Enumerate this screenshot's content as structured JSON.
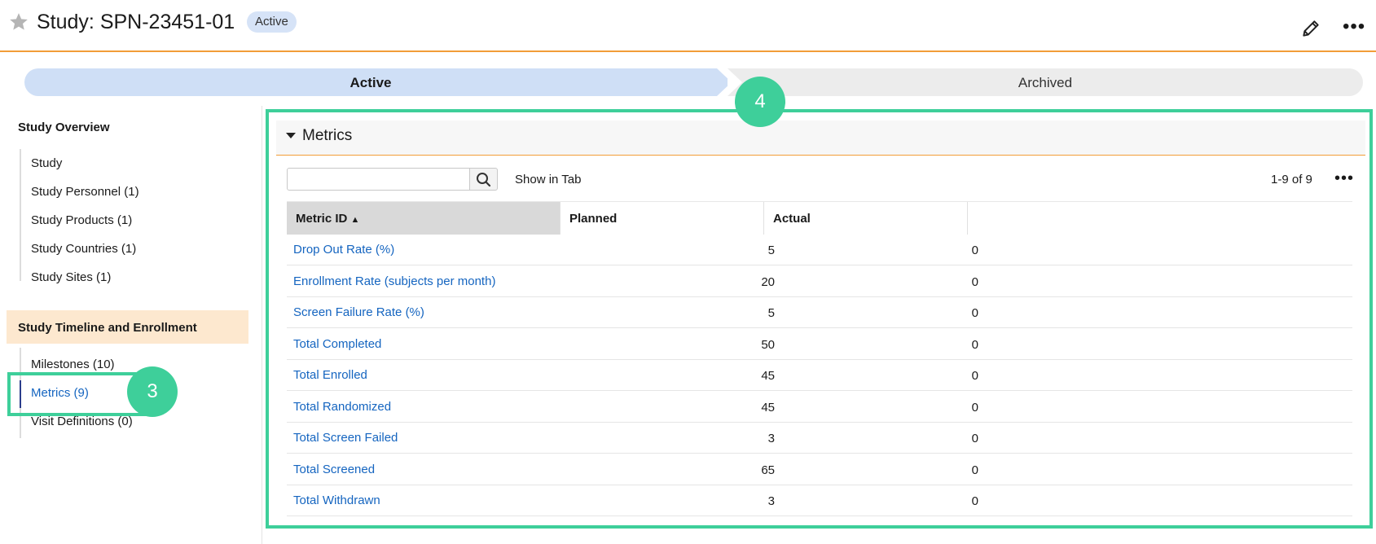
{
  "header": {
    "title": "Study: SPN-23451-01",
    "status_badge": "Active",
    "favorite_icon": "star-icon",
    "edit_icon": "pencil-icon",
    "more_icon": "more-horizontal-icon"
  },
  "lifecycle": {
    "stages": [
      "Active",
      "Archived"
    ],
    "current": "Active"
  },
  "sidebar": {
    "section_overview": "Study Overview",
    "overview_items": [
      "Study",
      "Study Personnel (1)",
      "Study Products (1)",
      "Study Countries (1)",
      "Study Sites (1)"
    ],
    "section_timeline": "Study Timeline and Enrollment",
    "timeline_items": [
      "Milestones (10)",
      "Metrics (9)",
      "Visit Definitions (0)"
    ],
    "active_item": "Metrics (9)"
  },
  "panel": {
    "title": "Metrics",
    "search_placeholder": "",
    "search_icon": "search-icon",
    "show_in_tab": "Show in Tab",
    "count": "1-9 of 9",
    "columns": [
      "Metric ID",
      "Planned",
      "Actual"
    ],
    "sort_column": "Metric ID",
    "rows": [
      {
        "metric": "Drop Out Rate (%)",
        "planned": "5",
        "actual": "0"
      },
      {
        "metric": "Enrollment Rate (subjects per month)",
        "planned": "20",
        "actual": "0"
      },
      {
        "metric": "Screen Failure Rate (%)",
        "planned": "5",
        "actual": "0"
      },
      {
        "metric": "Total Completed",
        "planned": "50",
        "actual": "0"
      },
      {
        "metric": "Total Enrolled",
        "planned": "45",
        "actual": "0"
      },
      {
        "metric": "Total Randomized",
        "planned": "45",
        "actual": "0"
      },
      {
        "metric": "Total Screen Failed",
        "planned": "3",
        "actual": "0"
      },
      {
        "metric": "Total Screened",
        "planned": "65",
        "actual": "0"
      },
      {
        "metric": "Total Withdrawn",
        "planned": "3",
        "actual": "0"
      }
    ]
  },
  "callouts": {
    "sidebar_marker": "3",
    "panel_marker": "4",
    "color": "#3ecf9a"
  },
  "colors": {
    "accent_orange": "#f29d38",
    "link_blue": "#1565c0",
    "active_stage": "#cfdff6",
    "section_highlight": "#fde8cf"
  }
}
